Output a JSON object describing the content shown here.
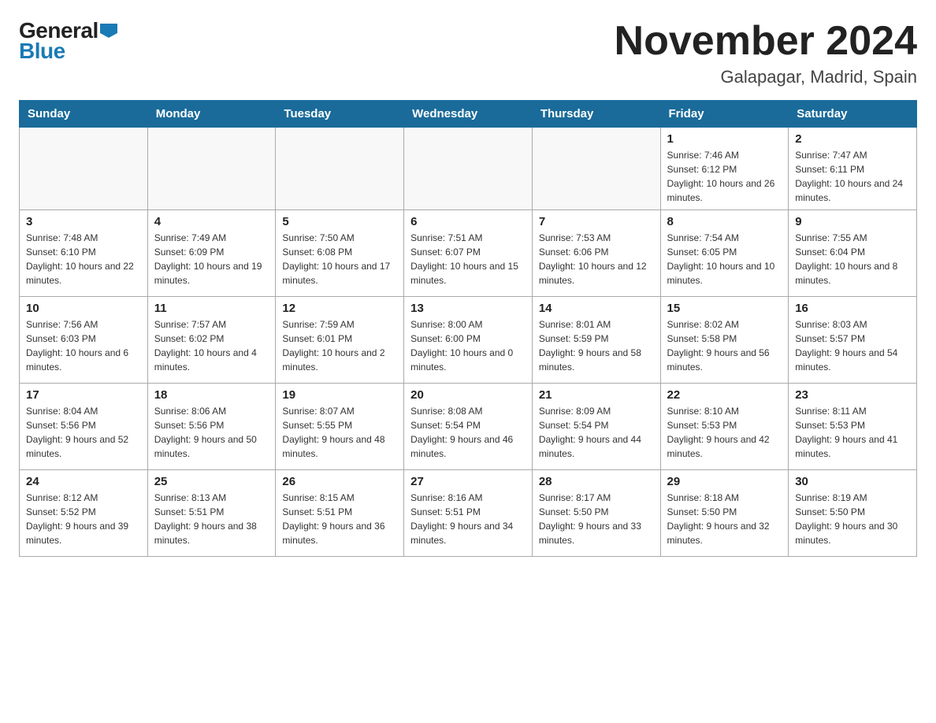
{
  "logo": {
    "general": "General",
    "blue": "Blue",
    "arrow": "▶"
  },
  "title": "November 2024",
  "subtitle": "Galapagar, Madrid, Spain",
  "weekdays": [
    "Sunday",
    "Monday",
    "Tuesday",
    "Wednesday",
    "Thursday",
    "Friday",
    "Saturday"
  ],
  "weeks": [
    [
      {
        "day": "",
        "info": ""
      },
      {
        "day": "",
        "info": ""
      },
      {
        "day": "",
        "info": ""
      },
      {
        "day": "",
        "info": ""
      },
      {
        "day": "",
        "info": ""
      },
      {
        "day": "1",
        "info": "Sunrise: 7:46 AM\nSunset: 6:12 PM\nDaylight: 10 hours and 26 minutes."
      },
      {
        "day": "2",
        "info": "Sunrise: 7:47 AM\nSunset: 6:11 PM\nDaylight: 10 hours and 24 minutes."
      }
    ],
    [
      {
        "day": "3",
        "info": "Sunrise: 7:48 AM\nSunset: 6:10 PM\nDaylight: 10 hours and 22 minutes."
      },
      {
        "day": "4",
        "info": "Sunrise: 7:49 AM\nSunset: 6:09 PM\nDaylight: 10 hours and 19 minutes."
      },
      {
        "day": "5",
        "info": "Sunrise: 7:50 AM\nSunset: 6:08 PM\nDaylight: 10 hours and 17 minutes."
      },
      {
        "day": "6",
        "info": "Sunrise: 7:51 AM\nSunset: 6:07 PM\nDaylight: 10 hours and 15 minutes."
      },
      {
        "day": "7",
        "info": "Sunrise: 7:53 AM\nSunset: 6:06 PM\nDaylight: 10 hours and 12 minutes."
      },
      {
        "day": "8",
        "info": "Sunrise: 7:54 AM\nSunset: 6:05 PM\nDaylight: 10 hours and 10 minutes."
      },
      {
        "day": "9",
        "info": "Sunrise: 7:55 AM\nSunset: 6:04 PM\nDaylight: 10 hours and 8 minutes."
      }
    ],
    [
      {
        "day": "10",
        "info": "Sunrise: 7:56 AM\nSunset: 6:03 PM\nDaylight: 10 hours and 6 minutes."
      },
      {
        "day": "11",
        "info": "Sunrise: 7:57 AM\nSunset: 6:02 PM\nDaylight: 10 hours and 4 minutes."
      },
      {
        "day": "12",
        "info": "Sunrise: 7:59 AM\nSunset: 6:01 PM\nDaylight: 10 hours and 2 minutes."
      },
      {
        "day": "13",
        "info": "Sunrise: 8:00 AM\nSunset: 6:00 PM\nDaylight: 10 hours and 0 minutes."
      },
      {
        "day": "14",
        "info": "Sunrise: 8:01 AM\nSunset: 5:59 PM\nDaylight: 9 hours and 58 minutes."
      },
      {
        "day": "15",
        "info": "Sunrise: 8:02 AM\nSunset: 5:58 PM\nDaylight: 9 hours and 56 minutes."
      },
      {
        "day": "16",
        "info": "Sunrise: 8:03 AM\nSunset: 5:57 PM\nDaylight: 9 hours and 54 minutes."
      }
    ],
    [
      {
        "day": "17",
        "info": "Sunrise: 8:04 AM\nSunset: 5:56 PM\nDaylight: 9 hours and 52 minutes."
      },
      {
        "day": "18",
        "info": "Sunrise: 8:06 AM\nSunset: 5:56 PM\nDaylight: 9 hours and 50 minutes."
      },
      {
        "day": "19",
        "info": "Sunrise: 8:07 AM\nSunset: 5:55 PM\nDaylight: 9 hours and 48 minutes."
      },
      {
        "day": "20",
        "info": "Sunrise: 8:08 AM\nSunset: 5:54 PM\nDaylight: 9 hours and 46 minutes."
      },
      {
        "day": "21",
        "info": "Sunrise: 8:09 AM\nSunset: 5:54 PM\nDaylight: 9 hours and 44 minutes."
      },
      {
        "day": "22",
        "info": "Sunrise: 8:10 AM\nSunset: 5:53 PM\nDaylight: 9 hours and 42 minutes."
      },
      {
        "day": "23",
        "info": "Sunrise: 8:11 AM\nSunset: 5:53 PM\nDaylight: 9 hours and 41 minutes."
      }
    ],
    [
      {
        "day": "24",
        "info": "Sunrise: 8:12 AM\nSunset: 5:52 PM\nDaylight: 9 hours and 39 minutes."
      },
      {
        "day": "25",
        "info": "Sunrise: 8:13 AM\nSunset: 5:51 PM\nDaylight: 9 hours and 38 minutes."
      },
      {
        "day": "26",
        "info": "Sunrise: 8:15 AM\nSunset: 5:51 PM\nDaylight: 9 hours and 36 minutes."
      },
      {
        "day": "27",
        "info": "Sunrise: 8:16 AM\nSunset: 5:51 PM\nDaylight: 9 hours and 34 minutes."
      },
      {
        "day": "28",
        "info": "Sunrise: 8:17 AM\nSunset: 5:50 PM\nDaylight: 9 hours and 33 minutes."
      },
      {
        "day": "29",
        "info": "Sunrise: 8:18 AM\nSunset: 5:50 PM\nDaylight: 9 hours and 32 minutes."
      },
      {
        "day": "30",
        "info": "Sunrise: 8:19 AM\nSunset: 5:50 PM\nDaylight: 9 hours and 30 minutes."
      }
    ]
  ]
}
